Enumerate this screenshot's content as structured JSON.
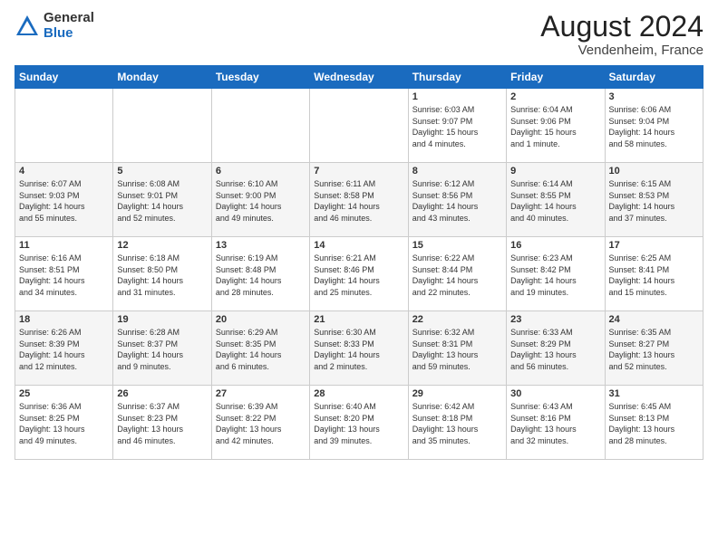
{
  "header": {
    "logo_general": "General",
    "logo_blue": "Blue",
    "month": "August 2024",
    "location": "Vendenheim, France"
  },
  "days_of_week": [
    "Sunday",
    "Monday",
    "Tuesday",
    "Wednesday",
    "Thursday",
    "Friday",
    "Saturday"
  ],
  "weeks": [
    [
      {
        "day": "",
        "content": ""
      },
      {
        "day": "",
        "content": ""
      },
      {
        "day": "",
        "content": ""
      },
      {
        "day": "",
        "content": ""
      },
      {
        "day": "1",
        "content": "Sunrise: 6:03 AM\nSunset: 9:07 PM\nDaylight: 15 hours\nand 4 minutes."
      },
      {
        "day": "2",
        "content": "Sunrise: 6:04 AM\nSunset: 9:06 PM\nDaylight: 15 hours\nand 1 minute."
      },
      {
        "day": "3",
        "content": "Sunrise: 6:06 AM\nSunset: 9:04 PM\nDaylight: 14 hours\nand 58 minutes."
      }
    ],
    [
      {
        "day": "4",
        "content": "Sunrise: 6:07 AM\nSunset: 9:03 PM\nDaylight: 14 hours\nand 55 minutes."
      },
      {
        "day": "5",
        "content": "Sunrise: 6:08 AM\nSunset: 9:01 PM\nDaylight: 14 hours\nand 52 minutes."
      },
      {
        "day": "6",
        "content": "Sunrise: 6:10 AM\nSunset: 9:00 PM\nDaylight: 14 hours\nand 49 minutes."
      },
      {
        "day": "7",
        "content": "Sunrise: 6:11 AM\nSunset: 8:58 PM\nDaylight: 14 hours\nand 46 minutes."
      },
      {
        "day": "8",
        "content": "Sunrise: 6:12 AM\nSunset: 8:56 PM\nDaylight: 14 hours\nand 43 minutes."
      },
      {
        "day": "9",
        "content": "Sunrise: 6:14 AM\nSunset: 8:55 PM\nDaylight: 14 hours\nand 40 minutes."
      },
      {
        "day": "10",
        "content": "Sunrise: 6:15 AM\nSunset: 8:53 PM\nDaylight: 14 hours\nand 37 minutes."
      }
    ],
    [
      {
        "day": "11",
        "content": "Sunrise: 6:16 AM\nSunset: 8:51 PM\nDaylight: 14 hours\nand 34 minutes."
      },
      {
        "day": "12",
        "content": "Sunrise: 6:18 AM\nSunset: 8:50 PM\nDaylight: 14 hours\nand 31 minutes."
      },
      {
        "day": "13",
        "content": "Sunrise: 6:19 AM\nSunset: 8:48 PM\nDaylight: 14 hours\nand 28 minutes."
      },
      {
        "day": "14",
        "content": "Sunrise: 6:21 AM\nSunset: 8:46 PM\nDaylight: 14 hours\nand 25 minutes."
      },
      {
        "day": "15",
        "content": "Sunrise: 6:22 AM\nSunset: 8:44 PM\nDaylight: 14 hours\nand 22 minutes."
      },
      {
        "day": "16",
        "content": "Sunrise: 6:23 AM\nSunset: 8:42 PM\nDaylight: 14 hours\nand 19 minutes."
      },
      {
        "day": "17",
        "content": "Sunrise: 6:25 AM\nSunset: 8:41 PM\nDaylight: 14 hours\nand 15 minutes."
      }
    ],
    [
      {
        "day": "18",
        "content": "Sunrise: 6:26 AM\nSunset: 8:39 PM\nDaylight: 14 hours\nand 12 minutes."
      },
      {
        "day": "19",
        "content": "Sunrise: 6:28 AM\nSunset: 8:37 PM\nDaylight: 14 hours\nand 9 minutes."
      },
      {
        "day": "20",
        "content": "Sunrise: 6:29 AM\nSunset: 8:35 PM\nDaylight: 14 hours\nand 6 minutes."
      },
      {
        "day": "21",
        "content": "Sunrise: 6:30 AM\nSunset: 8:33 PM\nDaylight: 14 hours\nand 2 minutes."
      },
      {
        "day": "22",
        "content": "Sunrise: 6:32 AM\nSunset: 8:31 PM\nDaylight: 13 hours\nand 59 minutes."
      },
      {
        "day": "23",
        "content": "Sunrise: 6:33 AM\nSunset: 8:29 PM\nDaylight: 13 hours\nand 56 minutes."
      },
      {
        "day": "24",
        "content": "Sunrise: 6:35 AM\nSunset: 8:27 PM\nDaylight: 13 hours\nand 52 minutes."
      }
    ],
    [
      {
        "day": "25",
        "content": "Sunrise: 6:36 AM\nSunset: 8:25 PM\nDaylight: 13 hours\nand 49 minutes."
      },
      {
        "day": "26",
        "content": "Sunrise: 6:37 AM\nSunset: 8:23 PM\nDaylight: 13 hours\nand 46 minutes."
      },
      {
        "day": "27",
        "content": "Sunrise: 6:39 AM\nSunset: 8:22 PM\nDaylight: 13 hours\nand 42 minutes."
      },
      {
        "day": "28",
        "content": "Sunrise: 6:40 AM\nSunset: 8:20 PM\nDaylight: 13 hours\nand 39 minutes."
      },
      {
        "day": "29",
        "content": "Sunrise: 6:42 AM\nSunset: 8:18 PM\nDaylight: 13 hours\nand 35 minutes."
      },
      {
        "day": "30",
        "content": "Sunrise: 6:43 AM\nSunset: 8:16 PM\nDaylight: 13 hours\nand 32 minutes."
      },
      {
        "day": "31",
        "content": "Sunrise: 6:45 AM\nSunset: 8:13 PM\nDaylight: 13 hours\nand 28 minutes."
      }
    ]
  ]
}
